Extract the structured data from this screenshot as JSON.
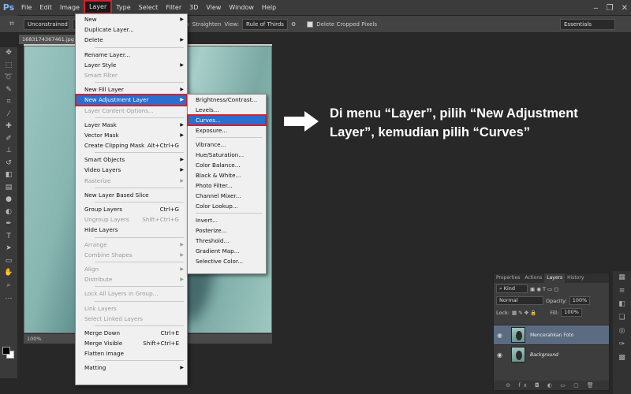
{
  "app": {
    "logo": "Ps"
  },
  "menubar": {
    "items": [
      "File",
      "Edit",
      "Image",
      "Layer",
      "Type",
      "Select",
      "Filter",
      "3D",
      "View",
      "Window",
      "Help"
    ],
    "active": "Layer"
  },
  "options": {
    "style": "Unconstrained",
    "straighten": "Straighten",
    "view_label": "View:",
    "view_value": "Rule of Thirds",
    "delete_cropped": "Delete Cropped Pixels",
    "workspace": "Essentials"
  },
  "document": {
    "tab": "1683174367461.jpg",
    "zoom": "100%"
  },
  "layer_menu": {
    "items": [
      {
        "label": "New",
        "arrow": true
      },
      {
        "label": "Duplicate Layer..."
      },
      {
        "label": "Delete",
        "arrow": true
      },
      {
        "sep": true
      },
      {
        "label": "Rename Layer..."
      },
      {
        "label": "Layer Style",
        "arrow": true
      },
      {
        "label": "Smart Filter",
        "disabled": true
      },
      {
        "sep": true
      },
      {
        "label": "New Fill Layer",
        "arrow": true
      },
      {
        "label": "New Adjustment Layer",
        "arrow": true,
        "highlight": true
      },
      {
        "label": "Layer Content Options...",
        "disabled": true
      },
      {
        "sep": true
      },
      {
        "label": "Layer Mask",
        "arrow": true
      },
      {
        "label": "Vector Mask",
        "arrow": true
      },
      {
        "label": "Create Clipping Mask",
        "shortcut": "Alt+Ctrl+G"
      },
      {
        "sep": true
      },
      {
        "label": "Smart Objects",
        "arrow": true
      },
      {
        "label": "Video Layers",
        "arrow": true
      },
      {
        "label": "Rasterize",
        "arrow": true,
        "disabled": true
      },
      {
        "sep": true
      },
      {
        "label": "New Layer Based Slice"
      },
      {
        "sep": true
      },
      {
        "label": "Group Layers",
        "shortcut": "Ctrl+G"
      },
      {
        "label": "Ungroup Layers",
        "shortcut": "Shift+Ctrl+G",
        "disabled": true
      },
      {
        "label": "Hide Layers"
      },
      {
        "sep": true
      },
      {
        "label": "Arrange",
        "arrow": true,
        "disabled": true
      },
      {
        "label": "Combine Shapes",
        "arrow": true,
        "disabled": true
      },
      {
        "sep": true
      },
      {
        "label": "Align",
        "arrow": true,
        "disabled": true
      },
      {
        "label": "Distribute",
        "arrow": true,
        "disabled": true
      },
      {
        "sep": true
      },
      {
        "label": "Lock All Layers in Group...",
        "disabled": true
      },
      {
        "sep": true
      },
      {
        "label": "Link Layers",
        "disabled": true
      },
      {
        "label": "Select Linked Layers",
        "disabled": true
      },
      {
        "sep": true
      },
      {
        "label": "Merge Down",
        "shortcut": "Ctrl+E"
      },
      {
        "label": "Merge Visible",
        "shortcut": "Shift+Ctrl+E"
      },
      {
        "label": "Flatten Image"
      },
      {
        "sep": true
      },
      {
        "label": "Matting",
        "arrow": true
      }
    ]
  },
  "adjustment_submenu": {
    "items": [
      {
        "label": "Brightness/Contrast..."
      },
      {
        "label": "Levels..."
      },
      {
        "label": "Curves...",
        "highlight": true
      },
      {
        "label": "Exposure..."
      },
      {
        "sep": true
      },
      {
        "label": "Vibrance..."
      },
      {
        "label": "Hue/Saturation..."
      },
      {
        "label": "Color Balance..."
      },
      {
        "label": "Black & White..."
      },
      {
        "label": "Photo Filter..."
      },
      {
        "label": "Channel Mixer..."
      },
      {
        "label": "Color Lookup..."
      },
      {
        "sep": true
      },
      {
        "label": "Invert..."
      },
      {
        "label": "Posterize..."
      },
      {
        "label": "Threshold..."
      },
      {
        "label": "Gradient Map..."
      },
      {
        "label": "Selective Color..."
      }
    ]
  },
  "annotation": {
    "line1": "Di menu “Layer”, pilih “New Adjustment",
    "line2": "Layer”, kemudian pilih “Curves”"
  },
  "layers_panel": {
    "tabs": [
      "Properties",
      "Actions",
      "Layers",
      "History"
    ],
    "active_tab": "Layers",
    "kind": "Kind",
    "blend_mode": "Normal",
    "opacity_label": "Opacity:",
    "opacity": "100%",
    "lock_label": "Lock:",
    "fill_label": "Fill:",
    "fill": "100%",
    "layers": [
      {
        "name": "Mencerahkan Foto",
        "selected": true
      },
      {
        "name": "Background",
        "italic": true
      }
    ],
    "footer_icons": "fx"
  },
  "colors": {
    "highlight": "#2a6fd0",
    "callout_border": "#d81e28"
  }
}
